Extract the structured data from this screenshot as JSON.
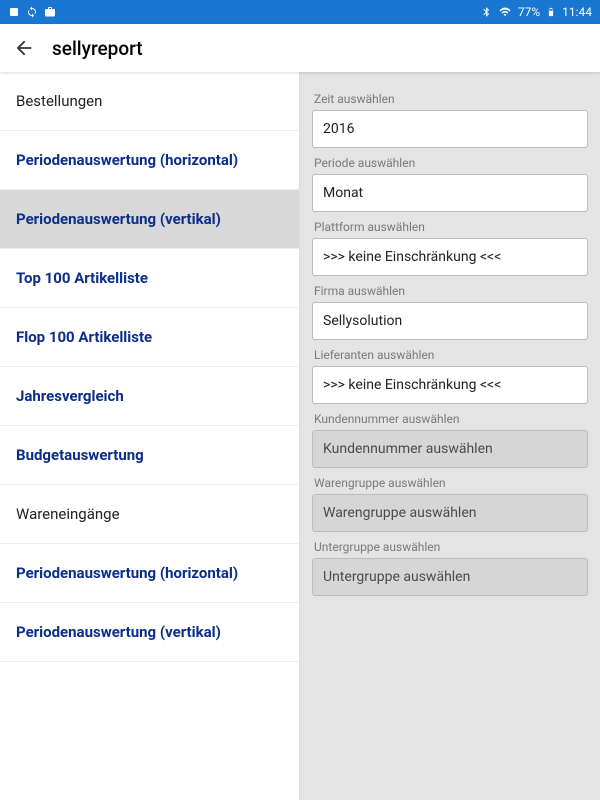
{
  "statusbar": {
    "battery": "77%",
    "time": "11:44"
  },
  "header": {
    "title": "sellyreport"
  },
  "sidebar": {
    "items": [
      {
        "label": "Bestellungen",
        "type": "header"
      },
      {
        "label": "Periodenauswertung (horizontal)",
        "type": "link"
      },
      {
        "label": "Periodenauswertung (vertikal)",
        "type": "link",
        "selected": true
      },
      {
        "label": "Top 100 Artikelliste",
        "type": "link"
      },
      {
        "label": "Flop 100 Artikelliste",
        "type": "link"
      },
      {
        "label": "Jahresvergleich",
        "type": "link"
      },
      {
        "label": "Budgetauswertung",
        "type": "link"
      },
      {
        "label": "Wareneingänge",
        "type": "header"
      },
      {
        "label": "Periodenauswertung (horizontal)",
        "type": "link"
      },
      {
        "label": "Periodenauswertung (vertikal)",
        "type": "link"
      }
    ]
  },
  "detail": {
    "fields": [
      {
        "label": "Zeit auswählen",
        "value": "2016",
        "muted": false
      },
      {
        "label": "Periode auswählen",
        "value": "Monat",
        "muted": false
      },
      {
        "label": "Plattform auswählen",
        "value": ">>> keine Einschränkung <<<",
        "muted": false
      },
      {
        "label": "Firma auswählen",
        "value": "Sellysolution",
        "muted": false
      },
      {
        "label": "Lieferanten auswählen",
        "value": ">>> keine Einschränkung <<<",
        "muted": false
      },
      {
        "label": "Kundennummer auswählen",
        "value": "Kundennummer auswählen",
        "muted": true
      },
      {
        "label": "Warengruppe auswählen",
        "value": "Warengruppe auswählen",
        "muted": true
      },
      {
        "label": "Untergruppe auswählen",
        "value": "Untergruppe auswählen",
        "muted": true
      }
    ]
  }
}
